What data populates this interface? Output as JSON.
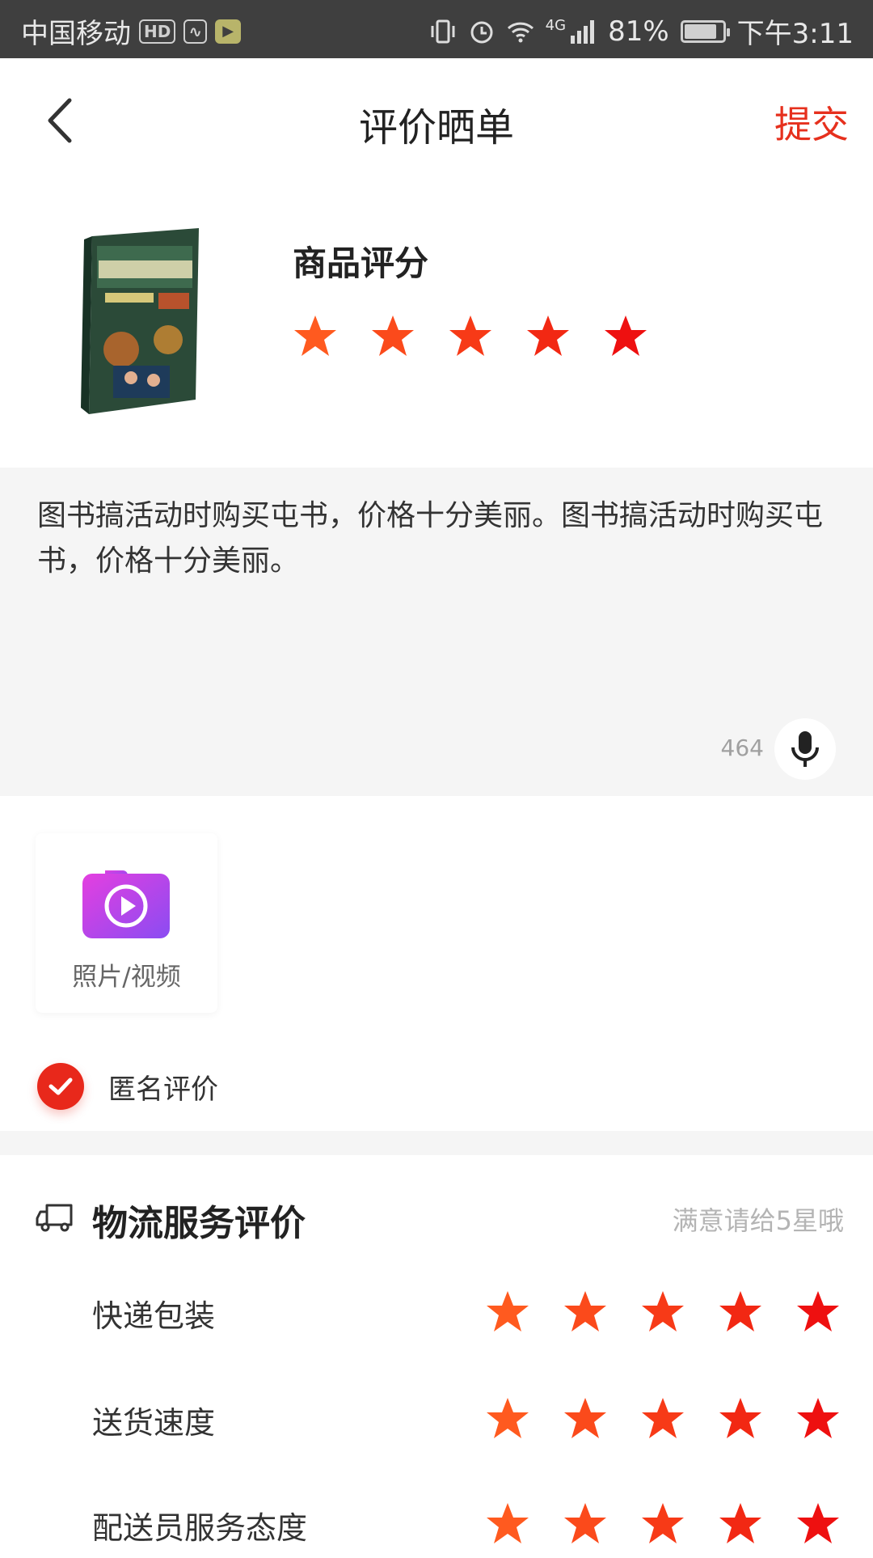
{
  "status_bar": {
    "carrier": "中国移动",
    "hd_badge": "HD",
    "network": "4G",
    "battery": "81%",
    "time": "下午3:11"
  },
  "nav": {
    "title": "评价晒单",
    "submit_label": "提交"
  },
  "product": {
    "rating_title": "商品评分",
    "rating": 5,
    "max_rating": 5
  },
  "comment": {
    "text": "图书搞活动时购买屯书，价格十分美丽。图书搞活动时购买屯书，价格十分美丽。",
    "remaining_chars": "464"
  },
  "media": {
    "label": "照片/视频"
  },
  "anonymous": {
    "label": "匿名评价",
    "checked": true
  },
  "logistics": {
    "title": "物流服务评价",
    "hint": "满意请给5星哦",
    "items": [
      {
        "label": "快递包装",
        "rating": 5
      },
      {
        "label": "送货速度",
        "rating": 5
      },
      {
        "label": "配送员服务态度",
        "rating": 5
      }
    ]
  },
  "colors": {
    "accent": "#e6301d",
    "star_start": "#ff5a1f",
    "star_end": "#ee1010"
  }
}
